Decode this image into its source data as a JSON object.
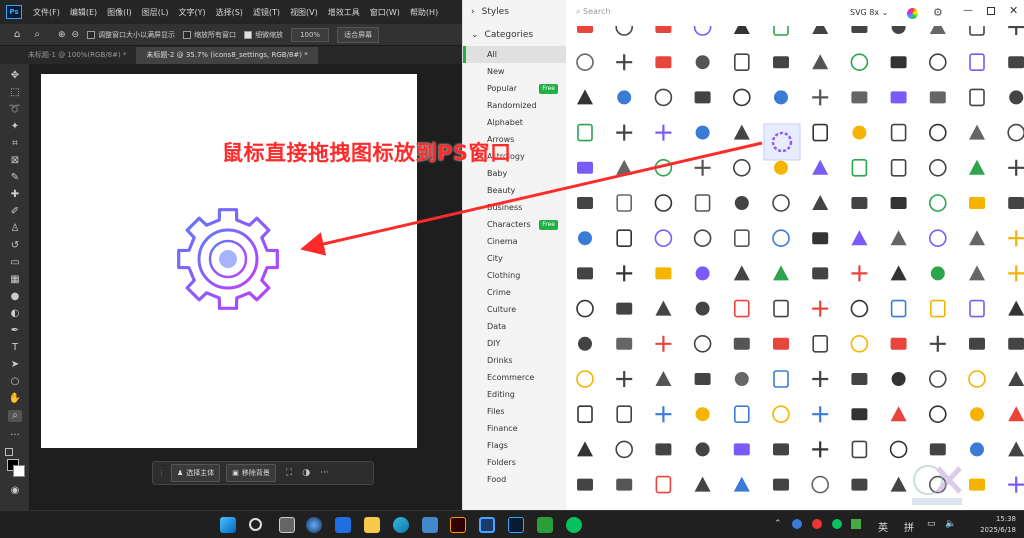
{
  "photoshop": {
    "logo": "Ps",
    "menu": [
      "文件(F)",
      "编辑(E)",
      "图像(I)",
      "图层(L)",
      "文字(Y)",
      "选择(S)",
      "滤镜(T)",
      "视图(V)",
      "增效工具",
      "窗口(W)",
      "帮助(H)"
    ],
    "options": {
      "resize_windows": "调整窗口大小以满屏显示",
      "zoom_all": "缩放所有窗口",
      "scrubby_zoom": "细微缩放",
      "zoom_value": "100%",
      "fit_screen": "适合屏幕"
    },
    "tabs": [
      "未标题-1 @ 100%(RGB/8#) *",
      "未标题-2 @ 35.7% (icons8_settings, RGB/8#) *"
    ],
    "contextbar": {
      "select_subject": "选择主体",
      "remove_bg": "移除背景",
      "more": "···"
    }
  },
  "icons8": {
    "styles_label": "Styles",
    "categories_label": "Categories",
    "categories": [
      {
        "label": "All",
        "active": true
      },
      {
        "label": "New"
      },
      {
        "label": "Popular",
        "badge": "Free"
      },
      {
        "label": "Randomized"
      },
      {
        "label": "Alphabet"
      },
      {
        "label": "Arrows"
      },
      {
        "label": "Astrology"
      },
      {
        "label": "Baby"
      },
      {
        "label": "Beauty"
      },
      {
        "label": "Business"
      },
      {
        "label": "Characters",
        "badge": "Free"
      },
      {
        "label": "Cinema"
      },
      {
        "label": "City"
      },
      {
        "label": "Clothing"
      },
      {
        "label": "Crime"
      },
      {
        "label": "Culture"
      },
      {
        "label": "Data"
      },
      {
        "label": "DIY"
      },
      {
        "label": "Drinks"
      },
      {
        "label": "Ecommerce"
      },
      {
        "label": "Editing"
      },
      {
        "label": "Files"
      },
      {
        "label": "Finance"
      },
      {
        "label": "Flags"
      },
      {
        "label": "Folders"
      },
      {
        "label": "Food"
      }
    ],
    "search_placeholder": "Search",
    "format": "SVG 8x"
  },
  "annotation": {
    "text": "鼠标直接拖拽图标放到PS窗口"
  },
  "taskbar": {
    "ime_en": "英",
    "ime_py": "拼",
    "time": "15:38",
    "date": "2025/6/18"
  },
  "colors": {
    "gear_start": "#5b7cfa",
    "gear_end": "#c13cff",
    "annotation": "#ff2b2b",
    "free_badge": "#1fb141"
  }
}
